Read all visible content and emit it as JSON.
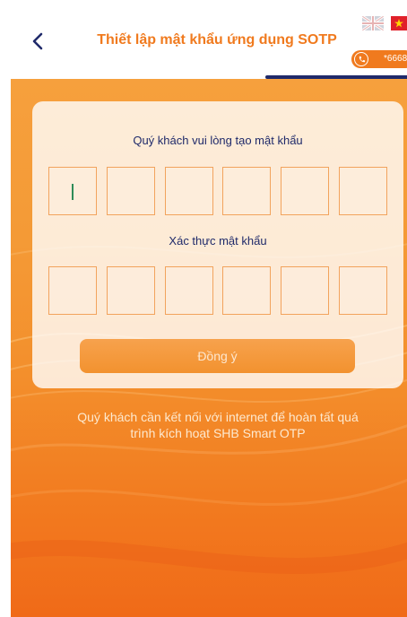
{
  "header": {
    "title": "Thiết lập mật khẩu ứng dụng SOTP",
    "phone_masked": "*6668"
  },
  "form": {
    "create_label": "Quý khách vui lòng tạo mật khẩu",
    "confirm_label": "Xác thực mật khẩu",
    "pin_length": 6,
    "create_value": "",
    "confirm_value": "",
    "submit_label": "Đồng ý"
  },
  "notice": {
    "line1": "Quý khách cần kết nối với internet để hoàn tất quá",
    "line2": "trình kích hoạt SHB Smart OTP"
  },
  "icons": {
    "back": "chevron-left-icon",
    "language_en": "uk-flag-icon",
    "language_vi": "vietnam-flag-icon",
    "phone": "phone-icon"
  },
  "colors": {
    "accent": "#f07a1e",
    "navy": "#1f2a6a",
    "box_border": "#f2a35d"
  }
}
